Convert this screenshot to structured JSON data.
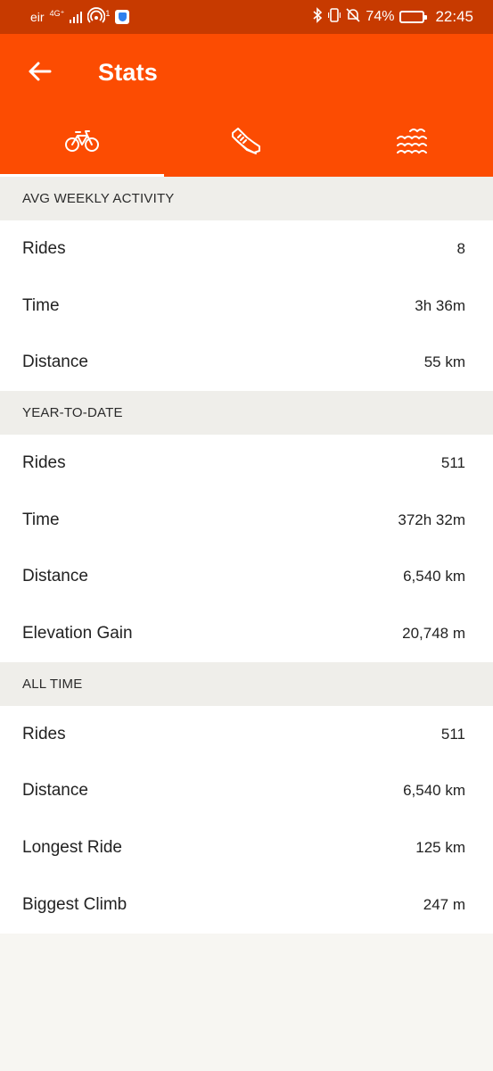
{
  "status_bar": {
    "carrier": "eir",
    "network": "4G⁺",
    "hotspot_count": "1",
    "battery_percent": "74%",
    "time": "22:45"
  },
  "header": {
    "title": "Stats",
    "back_icon": "arrow-left-icon"
  },
  "tabs": [
    {
      "icon": "bicycle-icon",
      "active": true
    },
    {
      "icon": "running-shoe-icon",
      "active": false
    },
    {
      "icon": "swim-waves-icon",
      "active": false
    }
  ],
  "colors": {
    "status_bar": "#c73a00",
    "accent": "#fc4c02",
    "section_header_bg": "#efeeea",
    "page_bg": "#f7f6f2"
  },
  "sections": {
    "weekly": {
      "title": "AVG WEEKLY ACTIVITY",
      "rows": [
        {
          "label": "Rides",
          "value": "8"
        },
        {
          "label": "Time",
          "value": "3h 36m"
        },
        {
          "label": "Distance",
          "value": "55 km"
        }
      ]
    },
    "ytd": {
      "title": "YEAR-TO-DATE",
      "rows": [
        {
          "label": "Rides",
          "value": "511"
        },
        {
          "label": "Time",
          "value": "372h 32m"
        },
        {
          "label": "Distance",
          "value": "6,540 km"
        },
        {
          "label": "Elevation Gain",
          "value": "20,748 m"
        }
      ]
    },
    "all_time": {
      "title": "ALL TIME",
      "rows": [
        {
          "label": "Rides",
          "value": "511"
        },
        {
          "label": "Distance",
          "value": "6,540 km"
        },
        {
          "label": "Longest Ride",
          "value": "125 km"
        },
        {
          "label": "Biggest Climb",
          "value": "247 m"
        }
      ]
    }
  }
}
